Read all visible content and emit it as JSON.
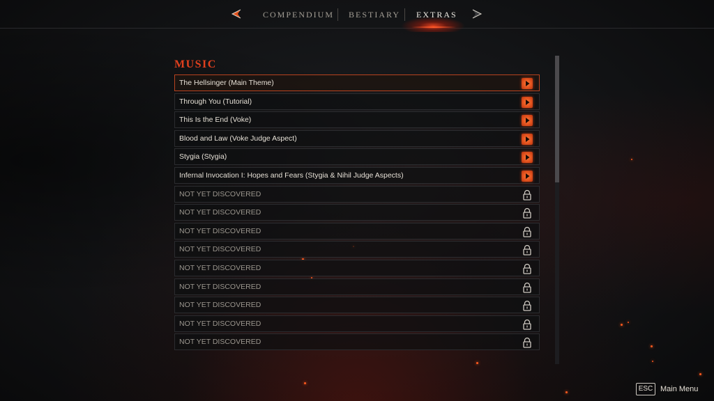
{
  "nav": {
    "tabs": [
      {
        "label": "COMPENDIUM",
        "active": false
      },
      {
        "label": "BESTIARY",
        "active": false
      },
      {
        "label": "EXTRAS",
        "active": true
      }
    ],
    "prev_icon": "chevron-left-icon",
    "next_icon": "chevron-right-icon"
  },
  "section": {
    "title": "MUSIC",
    "tracks": [
      {
        "label": "The Hellsinger (Main Theme)",
        "state": "unlocked",
        "icon": "play-icon"
      },
      {
        "label": "Through You (Tutorial)",
        "state": "unlocked",
        "icon": "play-icon"
      },
      {
        "label": "This Is the End (Voke)",
        "state": "unlocked",
        "icon": "play-icon"
      },
      {
        "label": "Blood and Law (Voke Judge Aspect)",
        "state": "unlocked",
        "icon": "play-icon"
      },
      {
        "label": "Stygia (Stygia)",
        "state": "unlocked",
        "icon": "play-icon"
      },
      {
        "label": "Infernal Invocation I: Hopes and Fears (Stygia & Nihil Judge Aspects)",
        "state": "unlocked",
        "icon": "play-icon"
      },
      {
        "label": "NOT YET DISCOVERED",
        "state": "locked",
        "icon": "lock-icon"
      },
      {
        "label": "NOT YET DISCOVERED",
        "state": "locked",
        "icon": "lock-icon"
      },
      {
        "label": "NOT YET DISCOVERED",
        "state": "locked",
        "icon": "lock-icon"
      },
      {
        "label": "NOT YET DISCOVERED",
        "state": "locked",
        "icon": "lock-icon"
      },
      {
        "label": "NOT YET DISCOVERED",
        "state": "locked",
        "icon": "lock-icon"
      },
      {
        "label": "NOT YET DISCOVERED",
        "state": "locked",
        "icon": "lock-icon"
      },
      {
        "label": "NOT YET DISCOVERED",
        "state": "locked",
        "icon": "lock-icon"
      },
      {
        "label": "NOT YET DISCOVERED",
        "state": "locked",
        "icon": "lock-icon"
      },
      {
        "label": "NOT YET DISCOVERED",
        "state": "locked",
        "icon": "lock-icon"
      }
    ]
  },
  "footer": {
    "key": "ESC",
    "label": "Main Menu"
  },
  "colors": {
    "accent": "#e0401e",
    "selected_border": "#b8431f",
    "play_button": "#e2521e"
  }
}
